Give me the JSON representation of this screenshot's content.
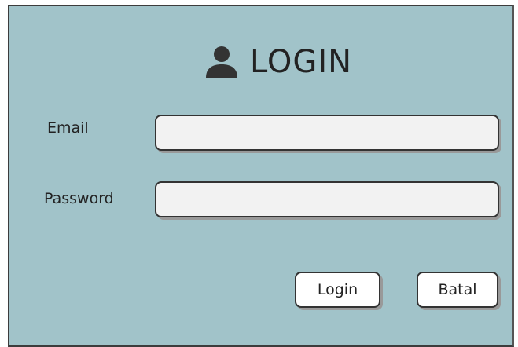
{
  "header": {
    "icon": "user-icon",
    "title": "LOGIN"
  },
  "form": {
    "email_label": "Email",
    "email_value": "",
    "email_placeholder": "",
    "password_label": "Password",
    "password_value": "",
    "password_placeholder": ""
  },
  "actions": {
    "login_label": "Login",
    "cancel_label": "Batal"
  },
  "colors": {
    "panel_background": "#a1c3c9",
    "input_background": "#f2f2f2",
    "button_background": "#ffffff",
    "text": "#222222"
  }
}
